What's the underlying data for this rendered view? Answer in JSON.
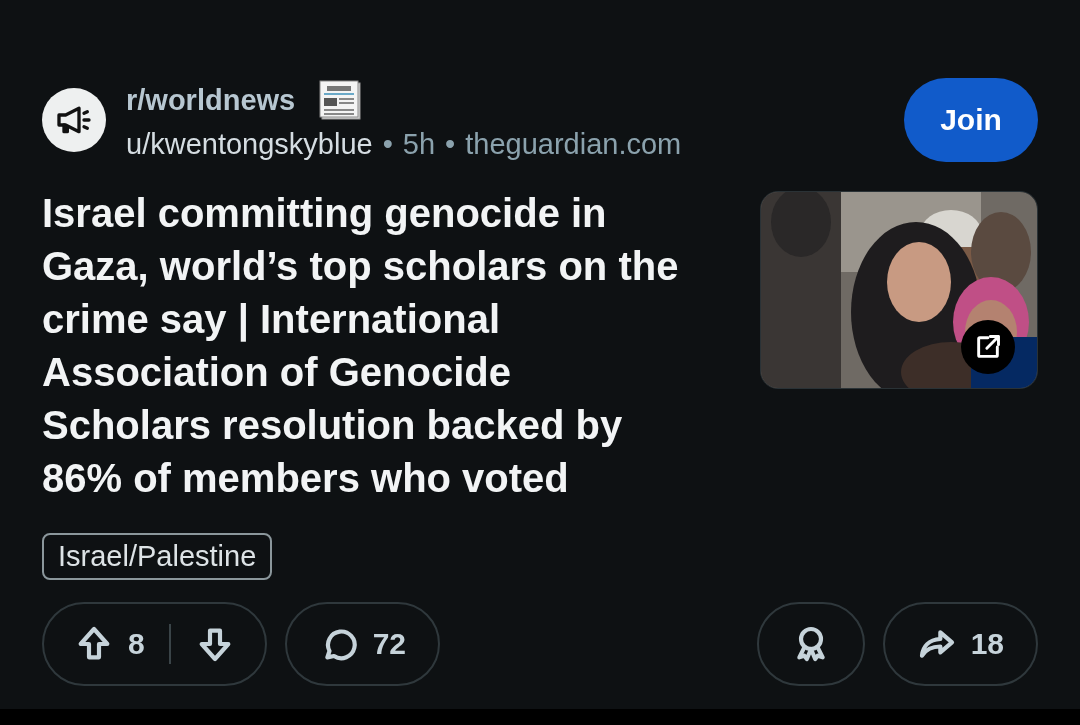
{
  "post": {
    "subreddit": "r/worldnews",
    "author": "u/kwentongskyblue",
    "age": "5h",
    "domain": "theguardian.com",
    "separator": "•",
    "join_button": "Join",
    "title": "Israel committing genocide in Gaza, world’s top scholars on the crime say | International Association of Genocide Scholars resolution backed by 86% of members who voted",
    "flair": "Israel/Palestine",
    "actions": {
      "votes": "8",
      "comments": "72",
      "shares": "18"
    }
  }
}
